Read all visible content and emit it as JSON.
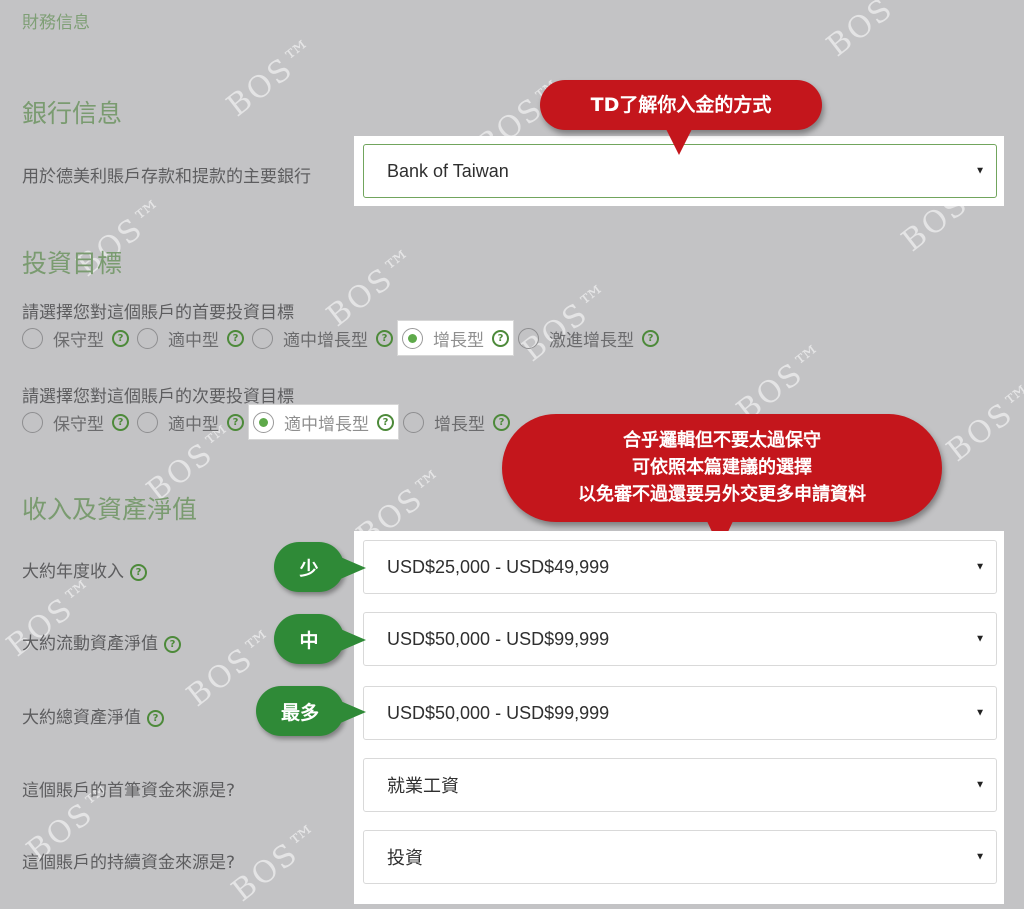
{
  "breadcrumb": "財務信息",
  "bank_section": {
    "title": "銀行信息",
    "label": "用於德美利賬戶存款和提款的主要銀行",
    "value": "Bank of Taiwan"
  },
  "goals_section": {
    "title": "投資目標",
    "primary_label": "請選擇您對這個賬戶的首要投資目標",
    "primary_options": [
      "保守型",
      "適中型",
      "適中增長型",
      "增長型",
      "激進增長型"
    ],
    "primary_selected": "增長型",
    "secondary_label": "請選擇您對這個賬戶的次要投資目標",
    "secondary_options": [
      "保守型",
      "適中型",
      "適中增長型",
      "增長型"
    ],
    "secondary_selected": "適中增長型"
  },
  "income_section": {
    "title": "收入及資產淨值",
    "fields": [
      {
        "label": "大約年度收入",
        "value": "USD$25,000 - USD$49,999",
        "help": true
      },
      {
        "label": "大約流動資產淨值",
        "value": "USD$50,000 - USD$99,999",
        "help": true
      },
      {
        "label": "大約總資產淨值",
        "value": "USD$50,000 - USD$99,999",
        "help": true
      },
      {
        "label": "這個賬戶的首筆資金來源是?",
        "value": "就業工資",
        "help": false
      },
      {
        "label": "這個賬戶的持續資金來源是?",
        "value": "投資",
        "help": false
      }
    ]
  },
  "annotations": {
    "bank_callout": "TD了解你入金的方式",
    "goal_callout": [
      "合乎邏輯但不要太過保守",
      "可依照本篇建議的選擇",
      "以免審不過還要另外交更多申請資料"
    ],
    "tags": [
      "少",
      "中",
      "最多"
    ]
  },
  "icons": {
    "help": "help-circle-icon",
    "caret": "caret-down-icon"
  },
  "watermark": "BOS™",
  "colors": {
    "accent_green": "#5ea94a",
    "callout_red": "#c4161c",
    "tag_green": "#2f8a37"
  }
}
